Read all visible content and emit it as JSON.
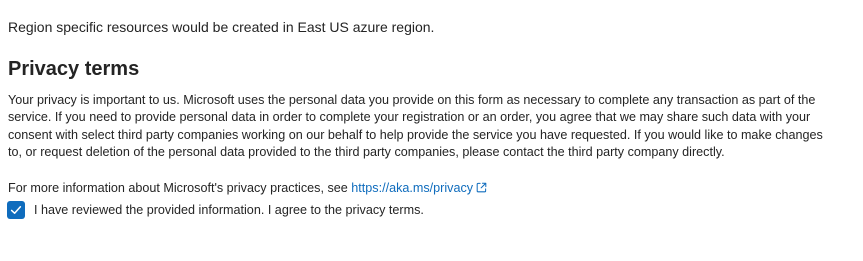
{
  "region_note": "Region specific resources would be created in East US azure region.",
  "privacy": {
    "heading": "Privacy terms",
    "body": "Your privacy is important to us. Microsoft uses the personal data you provide on this form as necessary to complete any transaction as part of the service. If you need to provide personal data in order to complete your registration or an order, you agree that we may share such data with your consent with select third party companies working on our behalf to help provide the service you have requested. If you would like to make changes to, or request deletion of the personal data provided to the third party companies, please contact the third party company directly.",
    "more_info_prefix": "For more information about Microsoft's privacy practices, see ",
    "link_text": "https://aka.ms/privacy",
    "link_icon": "external-link-icon",
    "agree_label": "I have reviewed the provided information. I agree to the privacy terms.",
    "agree_checked": true
  },
  "colors": {
    "accent": "#0f6cbd",
    "text": "#242424"
  }
}
